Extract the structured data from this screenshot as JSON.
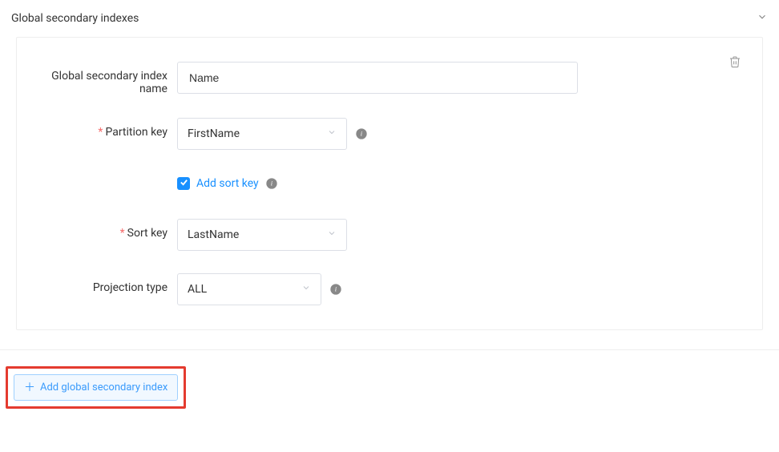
{
  "section": {
    "title": "Global secondary indexes"
  },
  "form": {
    "indexNameLabel": "Global secondary index name",
    "indexName": "Name",
    "partitionKeyLabel": "Partition key",
    "partitionKey": "FirstName",
    "addSortKeyLabel": "Add sort key",
    "sortKeyLabel": "Sort key",
    "sortKey": "LastName",
    "projectionTypeLabel": "Projection type",
    "projectionType": "ALL"
  },
  "addIndexButton": "Add global secondary index"
}
